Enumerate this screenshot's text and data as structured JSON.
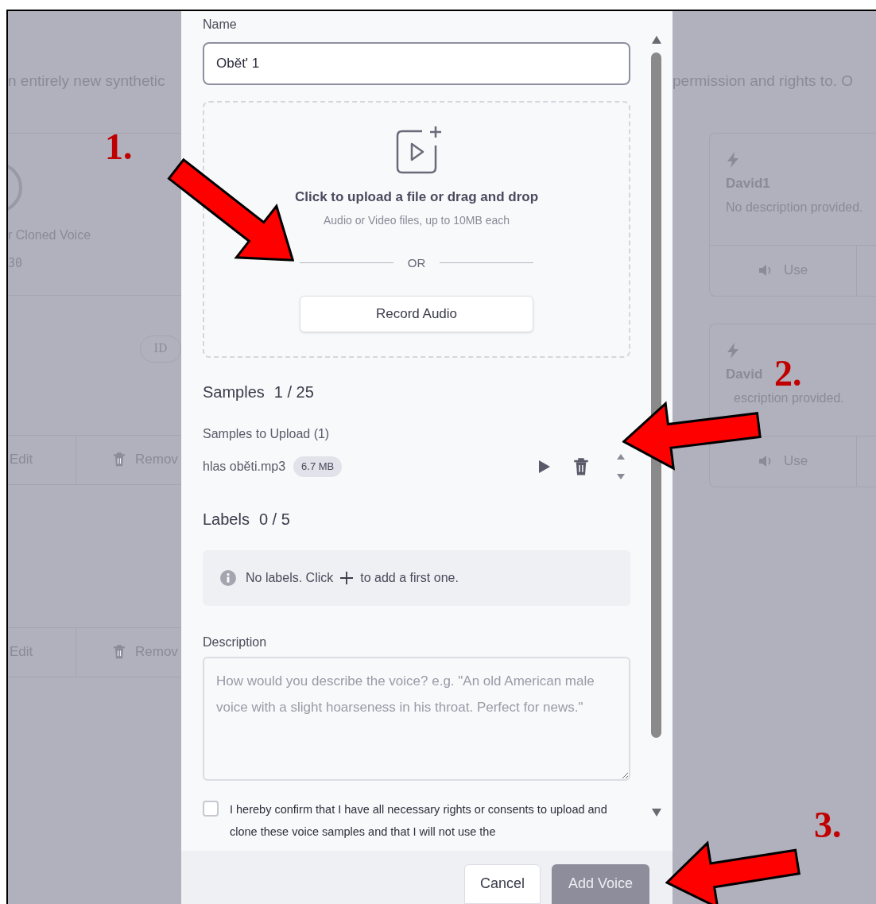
{
  "background": {
    "left_heading": "n entirely new synthetic",
    "right_heading": "permission and rights to. O",
    "left_voice": {
      "title": "r Cloned Voice",
      "meta": "30"
    },
    "left_badge": "ID",
    "left_action_rows": [
      {
        "edit": "Edit",
        "remove": "Remov"
      },
      {
        "edit": "Edit",
        "remove": "Remov"
      }
    ],
    "right_cards": [
      {
        "title": "David1",
        "description": "No description provided.",
        "action": "Use"
      },
      {
        "title": "David",
        "description": "escription provided.",
        "action": "Use"
      }
    ]
  },
  "modal": {
    "name_label": "Name",
    "name_value": "Obět' 1",
    "upload": {
      "title": "Click to upload a file or drag and drop",
      "hint": "Audio or Video files, up to 10MB each",
      "divider": "OR",
      "record_button": "Record Audio"
    },
    "samples_heading": "Samples",
    "samples_count": "1 / 25",
    "samples_to_upload": "Samples to Upload (1)",
    "files": [
      {
        "name": "hlas oběti.mp3",
        "size": "6.7 MB"
      }
    ],
    "labels_heading": "Labels",
    "labels_count": "0 / 5",
    "labels_empty": {
      "before": "No labels. Click",
      "after": "to add a first one."
    },
    "description_label": "Description",
    "description_placeholder": "How would you describe the voice? e.g. \"An old American male voice with a slight hoarseness in his throat. Perfect for news.\"",
    "consent": {
      "checked": false,
      "text": "I hereby confirm that I have all necessary rights or consents to upload and clone these voice samples and that I will not use the"
    },
    "cancel_button": "Cancel",
    "add_button": {
      "label": "Add Voice",
      "disabled": true
    }
  },
  "annotations": [
    {
      "label": "1."
    },
    {
      "label": "2."
    },
    {
      "label": "3."
    }
  ]
}
